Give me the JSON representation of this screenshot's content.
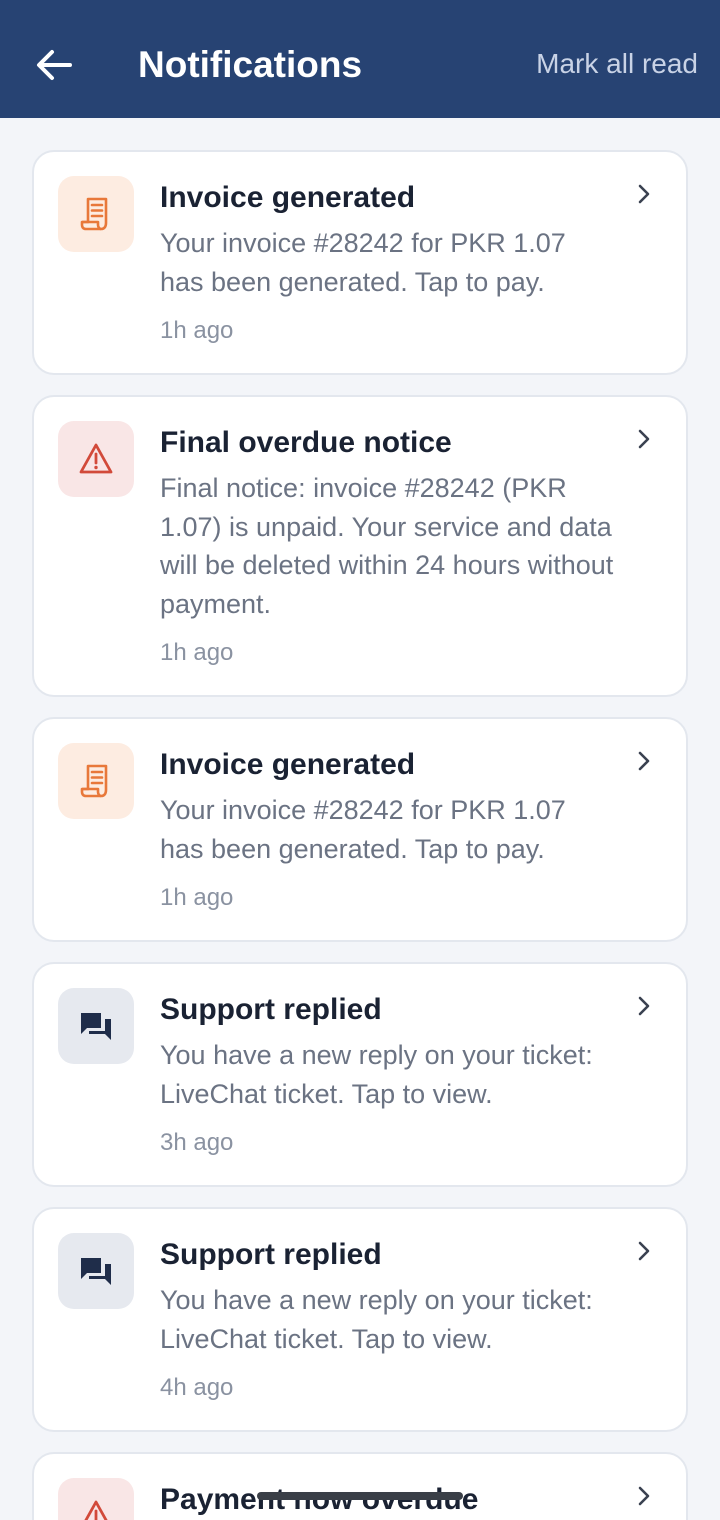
{
  "header": {
    "title": "Notifications",
    "mark_all_label": "Mark all read"
  },
  "colors": {
    "header_bg": "#274373",
    "invoice_accent": "#e8783a",
    "overdue_accent": "#d24a3a",
    "support_accent": "#1f2d4a"
  },
  "notifications": [
    {
      "icon": "receipt-icon",
      "title": "Invoice generated",
      "body": "Your invoice #28242 for PKR 1.07 has been generated. Tap to pay.",
      "time": "1h ago"
    },
    {
      "icon": "warning-icon",
      "title": "Final overdue notice",
      "body": "Final notice: invoice #28242 (PKR 1.07) is unpaid. Your service and data will be deleted within 24 hours without payment.",
      "time": "1h ago"
    },
    {
      "icon": "receipt-icon",
      "title": "Invoice generated",
      "body": "Your invoice #28242 for PKR 1.07 has been generated. Tap to pay.",
      "time": "1h ago"
    },
    {
      "icon": "chat-icon",
      "title": "Support replied",
      "body": "You have a new reply on your ticket: LiveChat ticket. Tap to view.",
      "time": "3h ago"
    },
    {
      "icon": "chat-icon",
      "title": "Support replied",
      "body": "You have a new reply on your ticket: LiveChat ticket. Tap to view.",
      "time": "4h ago"
    },
    {
      "icon": "warning-icon",
      "title": "Payment now overdue",
      "body": "",
      "time": ""
    }
  ]
}
